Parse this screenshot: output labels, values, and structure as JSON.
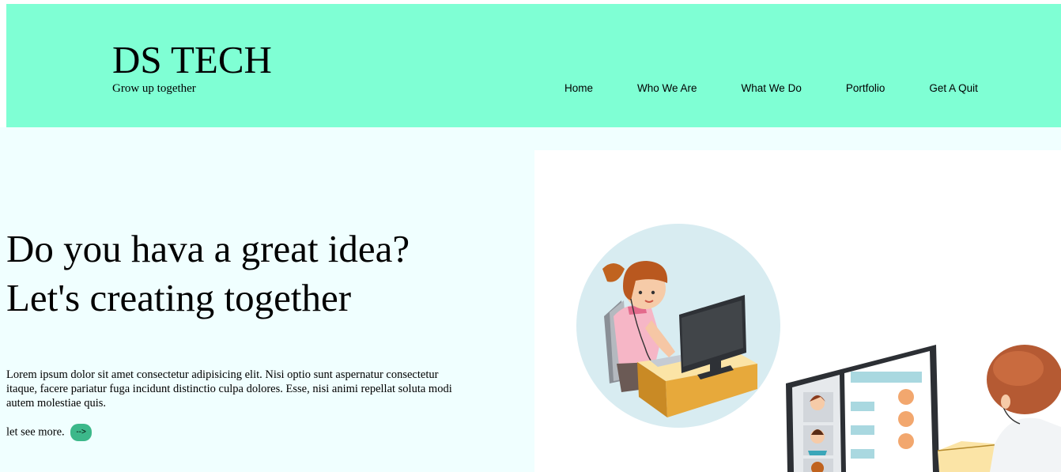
{
  "header": {
    "brand_title": "DS TECH",
    "brand_tagline": "Grow up together",
    "nav": [
      "Home",
      "Who We Are",
      "What We Do",
      "Portfolio",
      "Get A Quit"
    ]
  },
  "hero": {
    "headline_line1": "Do you hava a great idea?",
    "headline_line2": "Let's creating together",
    "paragraph": "Lorem ipsum dolor sit amet consectetur adipisicing elit. Nisi optio sunt aspernatur consectetur itaque, facere pariatur fuga incidunt distinctio culpa dolores. Esse, nisi animi repellat soluta modi autem molestiae quis.",
    "cta_text": "let see more.",
    "cta_button": "-->"
  },
  "colors": {
    "header_bg": "#7fffd4",
    "hero_bg": "#f0ffff",
    "button_bg": "#3cb88a"
  },
  "illustration": {
    "icon": "video-conference-illustration"
  }
}
